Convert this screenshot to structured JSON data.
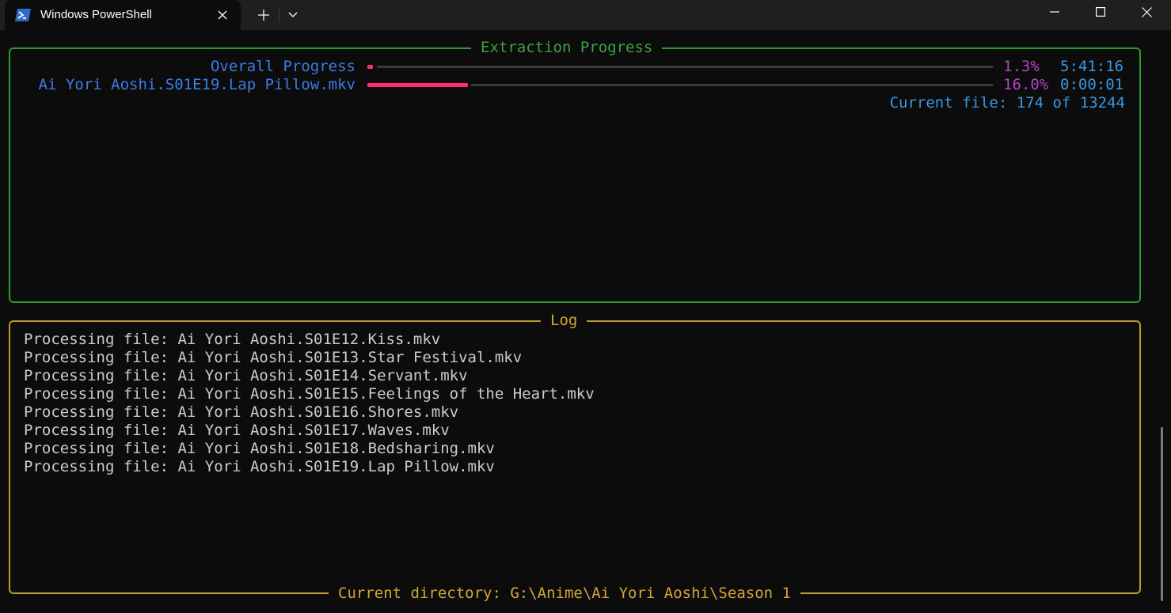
{
  "tab": {
    "icon": "powershell-icon",
    "title": "Windows PowerShell"
  },
  "progress_panel": {
    "title": "Extraction Progress",
    "overall": {
      "label": "Overall Progress",
      "fraction": 0.013,
      "percent": "1.3%",
      "time": "5:41:16"
    },
    "file": {
      "label": "Ai Yori Aoshi.S01E19.Lap Pillow.mkv",
      "fraction": 0.16,
      "percent": "16.0%",
      "time": "0:00:01"
    },
    "current_file": "Current file: 174 of 13244"
  },
  "log_panel": {
    "title": "Log",
    "lines": [
      "Processing file: Ai Yori Aoshi.S01E12.Kiss.mkv",
      "Processing file: Ai Yori Aoshi.S01E13.Star Festival.mkv",
      "Processing file: Ai Yori Aoshi.S01E14.Servant.mkv",
      "Processing file: Ai Yori Aoshi.S01E15.Feelings of the Heart.mkv",
      "Processing file: Ai Yori Aoshi.S01E16.Shores.mkv",
      "Processing file: Ai Yori Aoshi.S01E17.Waves.mkv",
      "Processing file: Ai Yori Aoshi.S01E18.Bedsharing.mkv",
      "Processing file: Ai Yori Aoshi.S01E19.Lap Pillow.mkv"
    ],
    "footer": "Current directory: G:\\Anime\\Ai Yori Aoshi\\Season 1"
  },
  "colors": {
    "progress_border": "#2d9a2d",
    "log_border": "#c09a2c",
    "bar_fill": "#ff2d6f",
    "label_blue": "#3e7be6",
    "percent_purple": "#b146c2",
    "time_blue": "#3c96dd"
  }
}
